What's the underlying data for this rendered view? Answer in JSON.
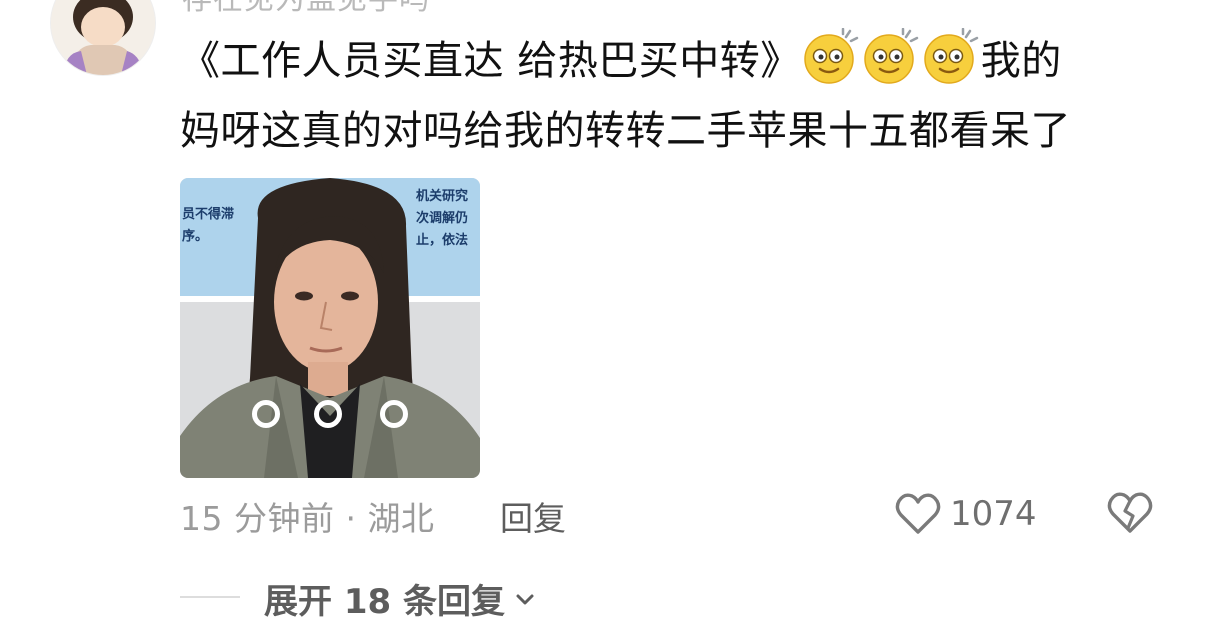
{
  "comment": {
    "username": "存在见为盖见手吗",
    "text_line1_start": "《工作人员买直达 给热巴买中转》",
    "text_line1_end": "我的",
    "text_line2": "妈呀这真的对吗给我的转转二手苹果十五都看呆了",
    "emojis": [
      "dazed-emoji",
      "dazed-emoji",
      "dazed-emoji"
    ],
    "image": {
      "sign_left_lines": [
        "员不得滞",
        "序。"
      ],
      "sign_right_lines": [
        "机关研究",
        "次调解仍",
        "止，依法"
      ]
    },
    "time_location": "15 分钟前 · 湖北",
    "reply_label": "回复",
    "like_count": "1074",
    "expand_label": "展开 18 条回复"
  }
}
